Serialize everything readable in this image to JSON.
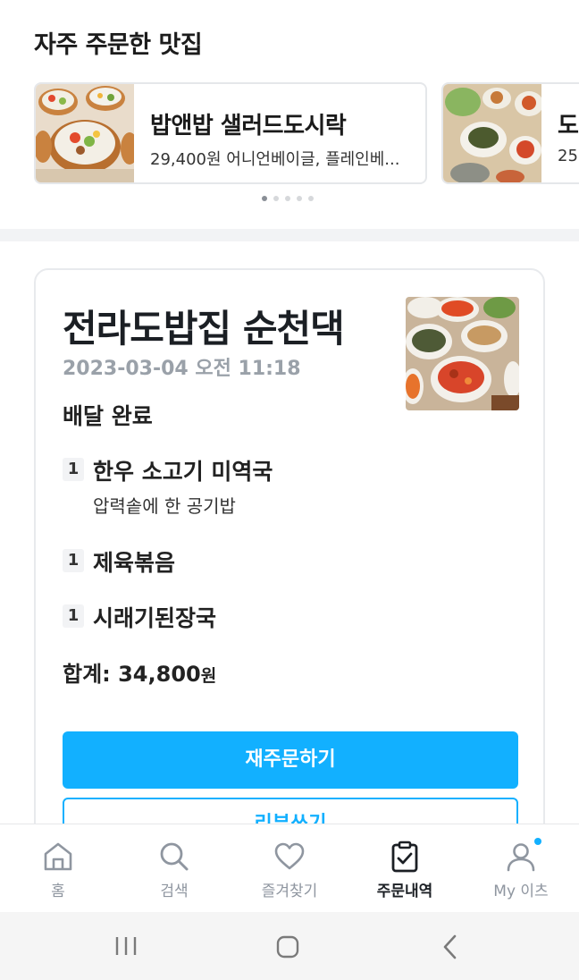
{
  "favorites": {
    "title": "자주 주문한 맛집",
    "cards": [
      {
        "name": "밥앤밥 샐러드도시락",
        "desc": "29,400원 어니언베이글, 플레인베..."
      },
      {
        "name": "도",
        "desc": "25,"
      }
    ],
    "pager": {
      "count": 5,
      "active": 0
    }
  },
  "order": {
    "restaurant": "전라도밥집 순천댁",
    "datetime": "2023-03-04 오전 11:18",
    "status": "배달 완료",
    "items": [
      {
        "qty": "1",
        "name": "한우 소고기 미역국",
        "option": "압력솥에 한 공기밥"
      },
      {
        "qty": "1",
        "name": "제육볶음",
        "option": ""
      },
      {
        "qty": "1",
        "name": "시래기된장국",
        "option": ""
      }
    ],
    "total_label": "합계: 34,800",
    "total_unit": "원",
    "reorder_label": "재주문하기",
    "review_label": "리뷰쓰기"
  },
  "tabbar": {
    "tabs": [
      {
        "label": "홈",
        "icon": "home-icon"
      },
      {
        "label": "검색",
        "icon": "search-icon"
      },
      {
        "label": "즐겨찾기",
        "icon": "heart-icon"
      },
      {
        "label": "주문내역",
        "icon": "clipboard-check-icon",
        "active": true
      },
      {
        "label": "My 이츠",
        "icon": "user-icon",
        "badge": true
      }
    ]
  },
  "colors": {
    "accent": "#12b0ff",
    "text": "#1b1f24",
    "muted": "#9aa1a9"
  }
}
